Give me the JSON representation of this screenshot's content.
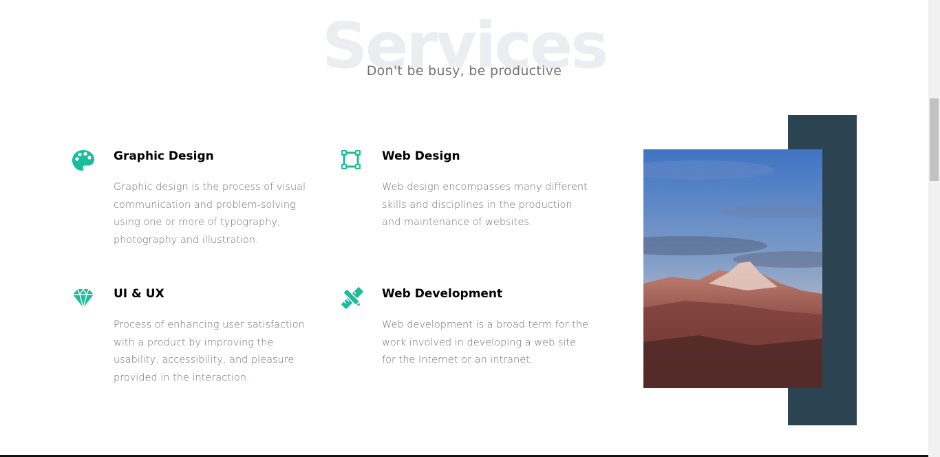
{
  "section": {
    "bg_title": "Services",
    "subtitle": "Don't be busy, be productive"
  },
  "services": [
    {
      "title": "Graphic Design",
      "description": "Graphic design is the process of visual communication and problem-solving using one or more of typography, photography and illustration.",
      "icon": "palette-icon"
    },
    {
      "title": "Web Design",
      "description": "Web design encompasses many different skills and disciplines in the production and maintenance of websites.",
      "icon": "vector-square-icon"
    },
    {
      "title": "UI & UX",
      "description": "Process of enhancing user satisfaction with a product by improving the usability, accessibility, and pleasure provided in the interaction.",
      "icon": "diamond-icon"
    },
    {
      "title": "Web Development",
      "description": "Web development is a broad term for the work involved in developing a web site for the Internet or an intranet.",
      "icon": "pencil-ruler-icon"
    }
  ],
  "colors": {
    "accent": "#1abc9c",
    "panel": "#2c4452",
    "heading": "#000000",
    "body_text": "#707070"
  }
}
